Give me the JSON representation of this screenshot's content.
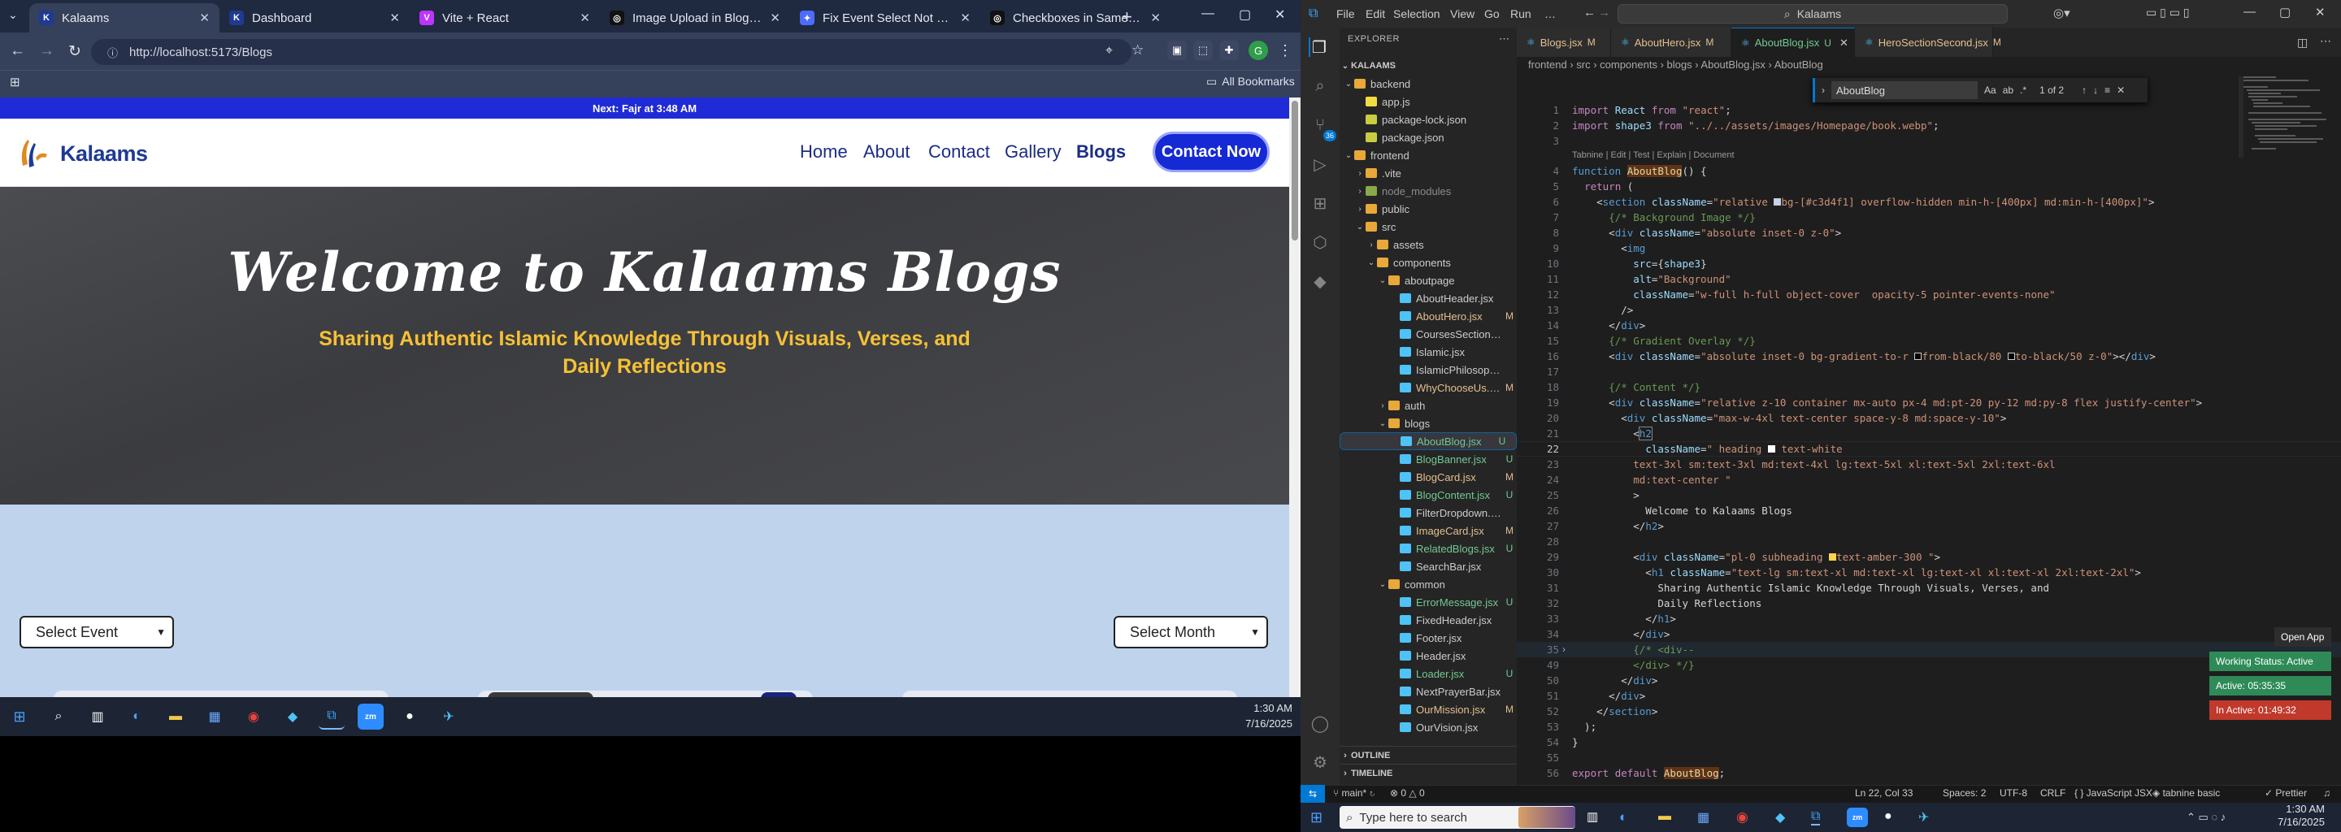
{
  "browser": {
    "tabs": [
      {
        "label": "Kalaams",
        "fav_color": "#1f3a93",
        "fav_glyph": "K"
      },
      {
        "label": "Dashboard",
        "fav_color": "#1f3a93",
        "fav_glyph": "K"
      },
      {
        "label": "Vite + React",
        "fav_color": "#bd34fe",
        "fav_glyph": "V"
      },
      {
        "label": "Image Upload in Blog Editor",
        "fav_color": "#111111",
        "fav_glyph": "◎"
      },
      {
        "label": "Fix Event Select Not Working",
        "fav_color": "#4d6bfe",
        "fav_glyph": "✦"
      },
      {
        "label": "Checkboxes in Same Row",
        "fav_color": "#111111",
        "fav_glyph": "◎"
      }
    ],
    "url": "http://localhost:5173/Blogs",
    "bookmarks_label": "All Bookmarks"
  },
  "site": {
    "prayer_text": "Next: Fajr at 3:48 AM",
    "logo_text": "Kalaams",
    "nav": [
      "Home",
      "About",
      "Contact",
      "Gallery",
      "Blogs"
    ],
    "contact_label": "Contact Now",
    "hero_title": "Welcome to Kalaams Blogs",
    "hero_subtitle": "Sharing Authentic Islamic Knowledge Through Visuals, Verses, and Daily Reflections",
    "select_event": "Select Event",
    "select_month": "Select Month"
  },
  "taskbar_left": {
    "time": "1:30 AM",
    "date": "7/16/2025"
  },
  "vscode": {
    "menu": [
      "File",
      "Edit",
      "Selection",
      "View",
      "Go",
      "Run",
      "…"
    ],
    "search_label": "Kalaams",
    "explorer_title": "EXPLORER",
    "root": "KALAAMS",
    "tree": [
      {
        "name": "backend",
        "type": "folder",
        "open": true,
        "depth": 0,
        "color": "#e8a83a"
      },
      {
        "name": "app.js",
        "type": "js",
        "depth": 1,
        "badge": ""
      },
      {
        "name": "package-lock.json",
        "type": "json",
        "depth": 1,
        "badge": ""
      },
      {
        "name": "package.json",
        "type": "json",
        "depth": 1,
        "badge": ""
      },
      {
        "name": "frontend",
        "type": "folder",
        "open": true,
        "depth": 0,
        "color": "#e8a83a"
      },
      {
        "name": ".vite",
        "type": "folder",
        "open": false,
        "depth": 1,
        "color": "#e8a83a"
      },
      {
        "name": "node_modules",
        "type": "folder",
        "open": false,
        "depth": 1,
        "color": "#8aa84a",
        "dim": true
      },
      {
        "name": "public",
        "type": "folder",
        "open": false,
        "depth": 1,
        "color": "#e8a83a"
      },
      {
        "name": "src",
        "type": "folder",
        "open": true,
        "depth": 1,
        "color": "#e8a83a"
      },
      {
        "name": "assets",
        "type": "folder",
        "open": false,
        "depth": 2,
        "color": "#e8a83a"
      },
      {
        "name": "components",
        "type": "folder",
        "open": true,
        "depth": 2,
        "color": "#e8a83a"
      },
      {
        "name": "aboutpage",
        "type": "folder",
        "open": true,
        "depth": 3,
        "color": "#e8a83a"
      },
      {
        "name": "AboutHeader.jsx",
        "type": "jsx",
        "depth": 4,
        "badge": ""
      },
      {
        "name": "AboutHero.jsx",
        "type": "jsx",
        "depth": 4,
        "badge": "M"
      },
      {
        "name": "CoursesSection.jsx",
        "type": "jsx",
        "depth": 4,
        "badge": ""
      },
      {
        "name": "Islamic.jsx",
        "type": "jsx",
        "depth": 4,
        "badge": ""
      },
      {
        "name": "IslamicPhilosophy.jsx",
        "type": "jsx",
        "depth": 4,
        "badge": ""
      },
      {
        "name": "WhyChooseUs.jsx",
        "type": "jsx",
        "depth": 4,
        "badge": "M"
      },
      {
        "name": "auth",
        "type": "folder",
        "open": false,
        "depth": 3,
        "color": "#e8a83a"
      },
      {
        "name": "blogs",
        "type": "folder",
        "open": true,
        "depth": 3,
        "color": "#e8a83a"
      },
      {
        "name": "AboutBlog.jsx",
        "type": "jsx",
        "depth": 4,
        "badge": "U",
        "selected": true
      },
      {
        "name": "BlogBanner.jsx",
        "type": "jsx",
        "depth": 4,
        "badge": "U"
      },
      {
        "name": "BlogCard.jsx",
        "type": "jsx",
        "depth": 4,
        "badge": "M"
      },
      {
        "name": "BlogContent.jsx",
        "type": "jsx",
        "depth": 4,
        "badge": "U"
      },
      {
        "name": "FilterDropdown.jsx",
        "type": "jsx",
        "depth": 4,
        "badge": ""
      },
      {
        "name": "ImageCard.jsx",
        "type": "jsx",
        "depth": 4,
        "badge": "M"
      },
      {
        "name": "RelatedBlogs.jsx",
        "type": "jsx",
        "depth": 4,
        "badge": "U"
      },
      {
        "name": "SearchBar.jsx",
        "type": "jsx",
        "depth": 4,
        "badge": ""
      },
      {
        "name": "common",
        "type": "folder",
        "open": true,
        "depth": 3,
        "color": "#e8a83a"
      },
      {
        "name": "ErrorMessage.jsx",
        "type": "jsx",
        "depth": 4,
        "badge": "U"
      },
      {
        "name": "FixedHeader.jsx",
        "type": "jsx",
        "depth": 4,
        "badge": ""
      },
      {
        "name": "Footer.jsx",
        "type": "jsx",
        "depth": 4,
        "badge": ""
      },
      {
        "name": "Header.jsx",
        "type": "jsx",
        "depth": 4,
        "badge": ""
      },
      {
        "name": "Loader.jsx",
        "type": "jsx",
        "depth": 4,
        "badge": "U"
      },
      {
        "name": "NextPrayerBar.jsx",
        "type": "jsx",
        "depth": 4,
        "badge": ""
      },
      {
        "name": "OurMission.jsx",
        "type": "jsx",
        "depth": 4,
        "badge": "M"
      },
      {
        "name": "OurVision.jsx",
        "type": "jsx",
        "depth": 4,
        "badge": ""
      }
    ],
    "outline_label": "OUTLINE",
    "timeline_label": "TIMELINE",
    "editor_tabs": [
      {
        "label": "Blogs.jsx",
        "badge": "M",
        "active": false
      },
      {
        "label": "AboutHero.jsx",
        "badge": "M",
        "active": false
      },
      {
        "label": "AboutBlog.jsx",
        "badge": "U",
        "active": true
      },
      {
        "label": "HeroSectionSecond.jsx",
        "badge": "M",
        "active": false
      }
    ],
    "breadcrumb": "frontend › src › components › blogs › AboutBlog.jsx › AboutBlog",
    "find": {
      "value": "AboutBlog",
      "result": "1 of 2"
    },
    "codelens": "Tabnine | Edit | Test | Explain | Document",
    "code_lines": [
      {
        "n": "1",
        "html": "<span class='kc'>import</span> <span class='a'>React</span> <span class='kc'>from</span> <span class='s'>\"react\"</span>;"
      },
      {
        "n": "2",
        "html": "<span class='kc'>import</span> <span class='a'>shape3</span> <span class='kc'>from</span> <span class='s'>\"../../assets/images/Homepage/book.webp\"</span>;"
      },
      {
        "n": "3",
        "html": ""
      },
      {
        "n": "4",
        "html": "<span class='k'>function</span> <span class='f' style='background:#613214'>AboutBlog</span>() {"
      },
      {
        "n": "5",
        "html": "  <span class='kc'>return</span> ("
      },
      {
        "n": "6",
        "html": "    &lt;<span class='tg'>section</span> <span class='a'>className</span>=<span class='s'>\"relative <span style='display:inline-block;width:9px;height:9px;background:#c3d4f1;border:1px solid #ccc'></span>bg-[#c3d4f1] overflow-hidden min-h-[400px] md:min-h-[400px]\"</span>&gt;"
      },
      {
        "n": "7",
        "html": "      <span class='c'>{/* Background Image */}</span>"
      },
      {
        "n": "8",
        "html": "      &lt;<span class='tg'>div</span> <span class='a'>className</span>=<span class='s'>\"absolute inset-0 z-0\"</span>&gt;"
      },
      {
        "n": "9",
        "html": "        &lt;<span class='tg'>img</span>"
      },
      {
        "n": "10",
        "html": "          <span class='a'>src</span>={<span class='a'>shape3</span>}"
      },
      {
        "n": "11",
        "html": "          <span class='a'>alt</span>=<span class='s'>\"Background\"</span>"
      },
      {
        "n": "12",
        "html": "          <span class='a'>className</span>=<span class='s'>\"w-full h-full object-cover  opacity-5 pointer-events-none\"</span>"
      },
      {
        "n": "13",
        "html": "        /&gt;"
      },
      {
        "n": "14",
        "html": "      &lt;/<span class='tg'>div</span>&gt;"
      },
      {
        "n": "15",
        "html": "      <span class='c'>{/* Gradient Overlay */}</span>"
      },
      {
        "n": "16",
        "html": "      &lt;<span class='tg'>div</span> <span class='a'>className</span>=<span class='s'>\"absolute inset-0 bg-gradient-to-r <span style='display:inline-block;width:9px;height:9px;background:#000;border:1px solid #ccc'></span>from-black/80 <span style='display:inline-block;width:9px;height:9px;background:#000;border:1px solid #ccc'></span>to-black/50 z-0\"</span>&gt;&lt;/<span class='tg'>div</span>&gt;"
      },
      {
        "n": "17",
        "html": ""
      },
      {
        "n": "18",
        "html": "      <span class='c'>{/* Content */}</span>"
      },
      {
        "n": "19",
        "html": "      &lt;<span class='tg'>div</span> <span class='a'>className</span>=<span class='s'>\"relative z-10 container mx-auto px-4 md:pt-20 py-12 md:py-8 flex justify-center\"</span>&gt;"
      },
      {
        "n": "20",
        "html": "        &lt;<span class='tg'>div</span> <span class='a'>className</span>=<span class='s'>\"max-w-4xl text-center space-y-8 md:space-y-10\"</span>&gt;"
      },
      {
        "n": "21",
        "html": "          &lt;<span class='tg' style='outline:1px solid #888'>h2</span>"
      },
      {
        "n": "22",
        "html": "            <span class='a'>className</span>=<span class='s'>\" heading <span style='display:inline-block;width:9px;height:9px;background:#fff'></span> text-white</span>",
        "current": true
      },
      {
        "n": "23",
        "html": "          <span class='s'>text-3xl sm:text-3xl md:text-4xl lg:text-5xl xl:text-5xl 2xl:text-6xl</span>"
      },
      {
        "n": "24",
        "html": "          <span class='s'>md:text-center \"</span>"
      },
      {
        "n": "25",
        "html": "          &gt;"
      },
      {
        "n": "26",
        "html": "            Welcome to Kalaams Blogs"
      },
      {
        "n": "27",
        "html": "          &lt;/<span class='tg'>h2</span>&gt;"
      },
      {
        "n": "28",
        "html": ""
      },
      {
        "n": "29",
        "html": "          &lt;<span class='tg'>div</span> <span class='a'>className</span>=<span class='s'>\"pl-0 subheading <span style='display:inline-block;width:9px;height:9px;background:#fcd34d'></span>text-amber-300 \"</span>&gt;"
      },
      {
        "n": "30",
        "html": "            &lt;<span class='tg'>h1</span> <span class='a'>className</span>=<span class='s'>\"text-lg sm:text-xl md:text-xl lg:text-xl xl:text-xl 2xl:text-2xl\"</span>&gt;"
      },
      {
        "n": "31",
        "html": "              Sharing Authentic Islamic Knowledge Through Visuals, Verses, and"
      },
      {
        "n": "32",
        "html": "              Daily Reflections"
      },
      {
        "n": "33",
        "html": "            &lt;/<span class='tg'>h1</span>&gt;"
      },
      {
        "n": "34",
        "html": "          &lt;/<span class='tg'>div</span>&gt;"
      },
      {
        "n": "35",
        "html": "          <span class='c'>{/* &lt;div--</span>",
        "fold": true
      },
      {
        "n": "49",
        "html": "          <span class='c'>&lt;/div&gt; */}</span>"
      },
      {
        "n": "50",
        "html": "        &lt;/<span class='tg'>div</span>&gt;"
      },
      {
        "n": "51",
        "html": "      &lt;/<span class='tg'>div</span>&gt;"
      },
      {
        "n": "52",
        "html": "    &lt;/<span class='tg'>section</span>&gt;"
      },
      {
        "n": "53",
        "html": "  );"
      },
      {
        "n": "54",
        "html": "}"
      },
      {
        "n": "55",
        "html": ""
      },
      {
        "n": "56",
        "html": "<span class='kc'>export</span> <span class='kc'>default</span> <span class='f' style='background:#613214'>AboutBlog</span>;"
      }
    ],
    "toasts": [
      {
        "label": "Open App",
        "color": "#2d2d2d"
      },
      {
        "label": "Working Status: Active",
        "color": "#2e8b57"
      },
      {
        "label": "Active: 05:35:35",
        "color": "#2e8b57"
      },
      {
        "label": "In Active: 01:49:32",
        "color": "#c0392b"
      }
    ],
    "status": {
      "branch": "main*",
      "problems": "⊗ 0 △ 0",
      "cursor": "Ln 22, Col 33",
      "spaces": "Spaces: 2",
      "encoding": "UTF-8",
      "eol": "CRLF",
      "language": "{ } JavaScript JSX",
      "tabnine": "tabnine basic",
      "prettier": "✓ Prettier"
    }
  },
  "taskbar_right": {
    "search_placeholder": "Type here to search",
    "time": "1:30 AM",
    "date": "7/16/2025"
  }
}
